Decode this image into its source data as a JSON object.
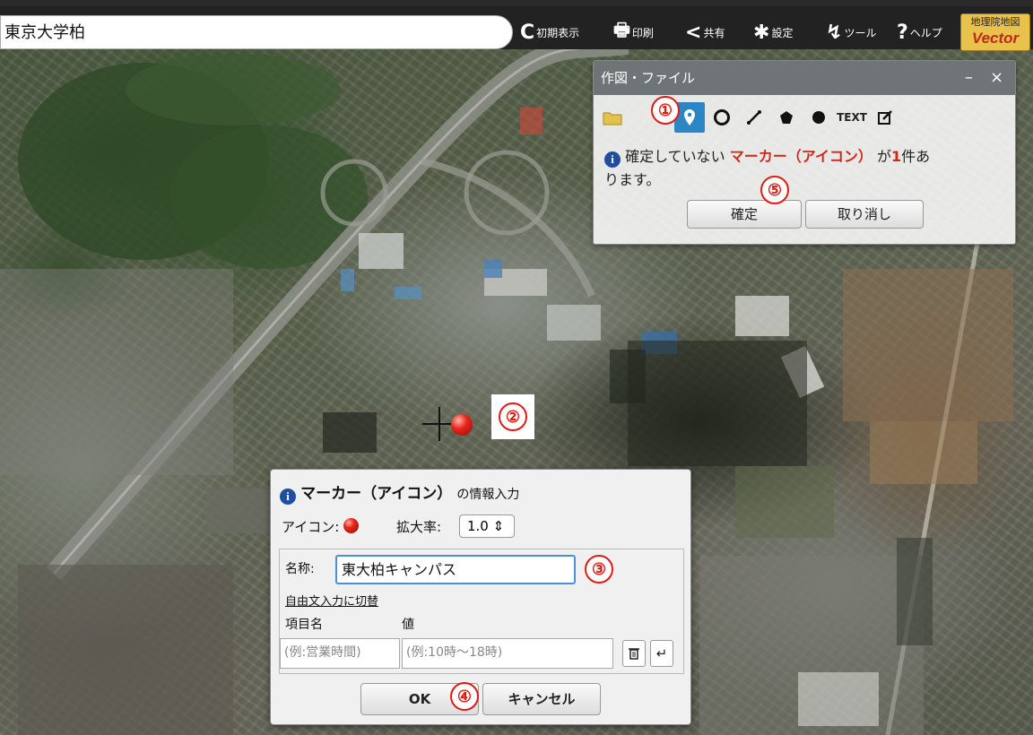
{
  "search": {
    "value": "東京大学柏"
  },
  "toolbar": [
    {
      "icon": "refresh-icon",
      "glyph": "C",
      "label": "初期表示"
    },
    {
      "icon": "print-icon",
      "glyph": "🖶",
      "label": "印刷"
    },
    {
      "icon": "share-icon",
      "glyph": "<",
      "label": "共有"
    },
    {
      "icon": "gear-icon",
      "glyph": "✱",
      "label": "設定"
    },
    {
      "icon": "tool-icon",
      "glyph": "↯",
      "label": "ツール"
    },
    {
      "icon": "help-icon",
      "glyph": "?",
      "label": "ヘルプ"
    }
  ],
  "logo": {
    "line1": "地理院地図",
    "line2": "Vector"
  },
  "draw_panel": {
    "title": "作図・ファイル",
    "minimize": "–",
    "close": "×",
    "tools": [
      "folder-icon",
      "marker-icon",
      "circle-icon",
      "line-icon",
      "polygon-icon",
      "dot-icon",
      "text-icon",
      "edit-icon"
    ],
    "text_tool": "TEXT",
    "msg_prefix": "確定していない",
    "msg_type": "マーカー（アイコン）",
    "msg_mid": "が",
    "msg_count": "1",
    "msg_suffix": "件あ",
    "msg_line2": "ります。",
    "confirm": "確定",
    "cancel": "取り消し"
  },
  "callouts": [
    "①",
    "②",
    "③",
    "④",
    "⑤"
  ],
  "marker_dialog": {
    "title_bold": "マーカー（アイコン）",
    "title_rest": "の情報入力",
    "icon_label": "アイコン:",
    "zoom_label": "拡大率:",
    "zoom_value": "1.0 ⇕",
    "name_label": "名称:",
    "name_value": "東大柏キャンパス",
    "freetext_link": "自由文入力に切替",
    "col_name": "項目名",
    "col_value": "値",
    "item_placeholder": "(例:営業時間)",
    "value_placeholder": "(例:10時〜18時)",
    "ok": "OK",
    "cancel": "キャンセル"
  },
  "colors": {
    "accent": "#2d86c4",
    "callout": "#e01b14",
    "highlight": "#d0271d"
  }
}
